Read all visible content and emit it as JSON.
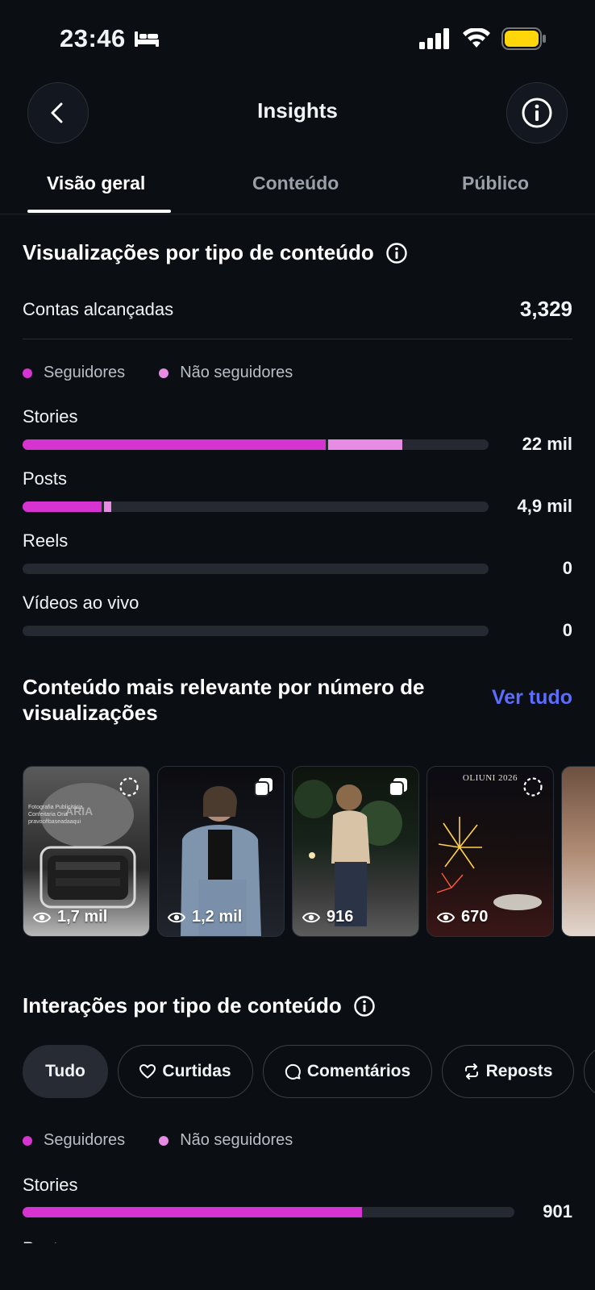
{
  "status": {
    "time": "23:46"
  },
  "header": {
    "title": "Insights"
  },
  "tabs": [
    {
      "label": "Visão geral",
      "active": true
    },
    {
      "label": "Conteúdo",
      "active": false
    },
    {
      "label": "Público",
      "active": false
    }
  ],
  "views_section": {
    "title": "Visualizações por tipo de conteúdo",
    "accounts_reached_label": "Contas alcançadas",
    "accounts_reached_value": "3,329",
    "legend": {
      "followers": "Seguidores",
      "non_followers": "Não seguidores"
    },
    "rows": [
      {
        "label": "Stories",
        "value": "22 mil",
        "followers_fraction": 0.65,
        "non_followers_fraction": 0.165
      },
      {
        "label": "Posts",
        "value": "4,9 mil",
        "followers_fraction": 0.17,
        "non_followers_fraction": 0.02
      },
      {
        "label": "Reels",
        "value": "0",
        "followers_fraction": 0,
        "non_followers_fraction": 0
      },
      {
        "label": "Vídeos ao vivo",
        "value": "0",
        "followers_fraction": 0,
        "non_followers_fraction": 0
      }
    ]
  },
  "top_content": {
    "title_line1": "Conteúdo mais relevante por número de",
    "title_line2": "visualizações",
    "see_all": "Ver tudo",
    "items": [
      {
        "views": "1,7 mil",
        "type": "story",
        "mini_text": [
          "Fotografia Publicitária",
          "Confeitaria Oria",
          "pravocêbaseadaaqui"
        ]
      },
      {
        "views": "1,2 mil",
        "type": "post"
      },
      {
        "views": "916",
        "type": "post"
      },
      {
        "views": "670",
        "type": "story",
        "banner": "OLIUNI 2026"
      }
    ]
  },
  "interactions_section": {
    "title": "Interações por tipo de conteúdo",
    "chips": [
      {
        "label": "Tudo",
        "icon": "",
        "selected": true
      },
      {
        "label": "Curtidas",
        "icon": "heart-icon",
        "selected": false
      },
      {
        "label": "Comentários",
        "icon": "comment-icon",
        "selected": false
      },
      {
        "label": "Reposts",
        "icon": "repost-icon",
        "selected": false
      }
    ],
    "legend": {
      "followers": "Seguidores",
      "non_followers": "Não seguidores"
    },
    "rows": [
      {
        "label": "Stories",
        "value": "901",
        "followers_fraction": 0.69,
        "non_followers_fraction": 0.004
      },
      {
        "label": "Posts"
      }
    ]
  },
  "colors": {
    "followers": "#d633d0",
    "non_followers": "#e88ce3",
    "accent_link": "#5b6cff",
    "background": "#0b0f14"
  }
}
